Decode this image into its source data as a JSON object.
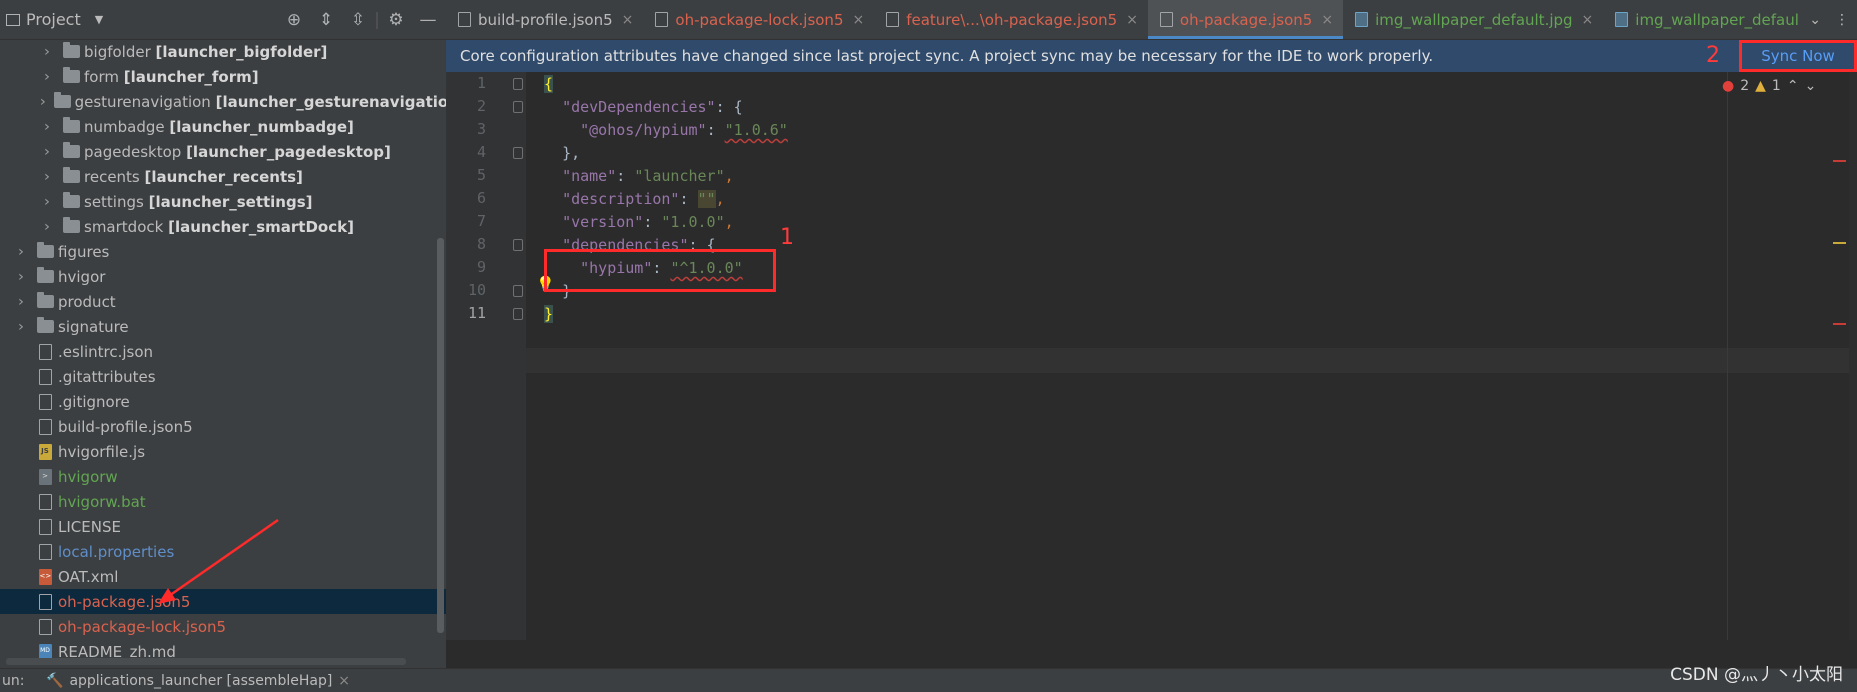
{
  "project_panel": {
    "title": "Project",
    "tree": [
      {
        "label": "bigfolder",
        "module": "[launcher_bigfolder]",
        "type": "folder",
        "expandable": true,
        "indent": 1
      },
      {
        "label": "form",
        "module": "[launcher_form]",
        "type": "folder",
        "expandable": true,
        "indent": 1
      },
      {
        "label": "gesturenavigation",
        "module": "[launcher_gesturenavigation]",
        "type": "folder",
        "expandable": true,
        "indent": 1
      },
      {
        "label": "numbadge",
        "module": "[launcher_numbadge]",
        "type": "folder",
        "expandable": true,
        "indent": 1
      },
      {
        "label": "pagedesktop",
        "module": "[launcher_pagedesktop]",
        "type": "folder",
        "expandable": true,
        "indent": 1
      },
      {
        "label": "recents",
        "module": "[launcher_recents]",
        "type": "folder",
        "expandable": true,
        "indent": 1
      },
      {
        "label": "settings",
        "module": "[launcher_settings]",
        "type": "folder",
        "expandable": true,
        "indent": 1
      },
      {
        "label": "smartdock",
        "module": "[launcher_smartDock]",
        "type": "folder",
        "expandable": true,
        "indent": 1
      },
      {
        "label": "figures",
        "module": "",
        "type": "folder",
        "expandable": true,
        "indent": 0
      },
      {
        "label": "hvigor",
        "module": "",
        "type": "folder",
        "expandable": true,
        "indent": 0
      },
      {
        "label": "product",
        "module": "",
        "type": "folder",
        "expandable": true,
        "indent": 0
      },
      {
        "label": "signature",
        "module": "",
        "type": "folder",
        "expandable": true,
        "indent": 0
      },
      {
        "label": ".eslintrc.json",
        "module": "",
        "type": "json",
        "expandable": false,
        "indent": 0
      },
      {
        "label": ".gitattributes",
        "module": "",
        "type": "text",
        "expandable": false,
        "indent": 0
      },
      {
        "label": ".gitignore",
        "module": "",
        "type": "text",
        "expandable": false,
        "indent": 0
      },
      {
        "label": "build-profile.json5",
        "module": "",
        "type": "json",
        "expandable": false,
        "indent": 0
      },
      {
        "label": "hvigorfile.js",
        "module": "",
        "type": "js",
        "expandable": false,
        "indent": 0
      },
      {
        "label": "hvigorw",
        "module": "",
        "type": "sh",
        "expandable": false,
        "indent": 0,
        "color": "green"
      },
      {
        "label": "hvigorw.bat",
        "module": "",
        "type": "text",
        "expandable": false,
        "indent": 0,
        "color": "green"
      },
      {
        "label": "LICENSE",
        "module": "",
        "type": "text",
        "expandable": false,
        "indent": 0
      },
      {
        "label": "local.properties",
        "module": "",
        "type": "text",
        "expandable": false,
        "indent": 0,
        "color": "blue"
      },
      {
        "label": "OAT.xml",
        "module": "",
        "type": "xml",
        "expandable": false,
        "indent": 0
      },
      {
        "label": "oh-package.json5",
        "module": "",
        "type": "json",
        "expandable": false,
        "indent": 0,
        "color": "red",
        "selected": true
      },
      {
        "label": "oh-package-lock.json5",
        "module": "",
        "type": "json",
        "expandable": false,
        "indent": 0,
        "color": "red"
      },
      {
        "label": "README_zh.md",
        "module": "",
        "type": "md",
        "expandable": false,
        "indent": 0
      }
    ]
  },
  "tabs": [
    {
      "label": "build-profile.json5",
      "color": "#bbbbbb",
      "icon": "json-file-icon"
    },
    {
      "label": "oh-package-lock.json5",
      "color": "#d9634f",
      "icon": "json-file-icon"
    },
    {
      "label": "feature\\...\\oh-package.json5",
      "color": "#d9634f",
      "icon": "json-file-icon"
    },
    {
      "label": "oh-package.json5",
      "color": "#d9634f",
      "icon": "json-file-icon",
      "active": true
    },
    {
      "label": "img_wallpaper_default.jpg",
      "color": "#62a552",
      "icon": "image-file-icon"
    },
    {
      "label": "img_wallpaper_defaul",
      "color": "#62a552",
      "icon": "image-file-icon"
    }
  ],
  "notification": {
    "message": "Core configuration attributes have changed since last project sync. A project sync may be necessary for the IDE to work properly.",
    "action": "Sync Now"
  },
  "editor": {
    "line_numbers": [
      "1",
      "2",
      "3",
      "4",
      "5",
      "6",
      "7",
      "8",
      "9",
      "10",
      "11"
    ],
    "current_line": "11",
    "inspections": {
      "errors": "2",
      "warnings": "1"
    },
    "code": {
      "l1": "{",
      "l2_key": "\"devDependencies\"",
      "l3_key": "\"@ohos/hypium\"",
      "l3_val": "\"1.0.6\"",
      "l4": "},",
      "l5_key": "\"name\"",
      "l5_val": "\"launcher\"",
      "l6_key": "\"description\"",
      "l6_val": "\"\"",
      "l7_key": "\"version\"",
      "l7_val": "\"1.0.0\"",
      "l8_key": "\"dependencies\"",
      "l9_key": "\"hypium\"",
      "l9_val": "\"^1.0.0\"",
      "l10": "}",
      "l11": "}"
    }
  },
  "annotations": {
    "one": "1",
    "two": "2"
  },
  "bottom": {
    "run_label": "un:",
    "run_tab": "applications_launcher [assembleHap]"
  },
  "watermark": "CSDN @灬丿丶小太阳",
  "colors": {
    "accent": "#4a88c7",
    "annotation": "#ff2a2a",
    "modified": "#d9634f"
  }
}
